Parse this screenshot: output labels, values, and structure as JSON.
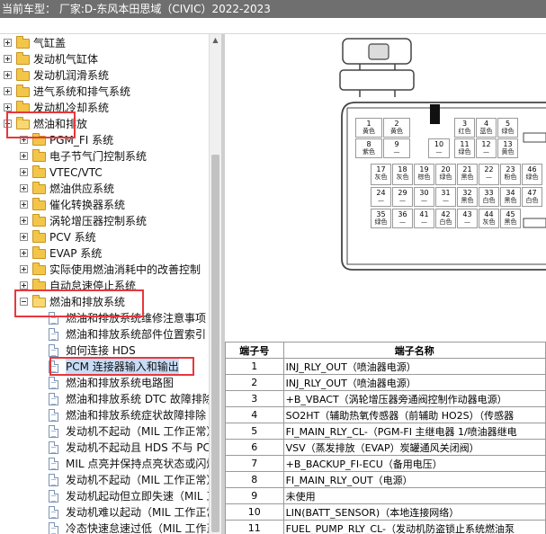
{
  "title_bar": "当前车型：  厂家:D-东风本田思域（CIVIC）2022-2023",
  "tree": [
    {
      "label": "气缸盖",
      "icon": "folder-icon",
      "level": 0,
      "expander": "plus"
    },
    {
      "label": "发动机气缸体",
      "icon": "folder-icon",
      "level": 0,
      "expander": "plus"
    },
    {
      "label": "发动机润滑系统",
      "icon": "folder-icon",
      "level": 0,
      "expander": "plus"
    },
    {
      "label": "进气系统和排气系统",
      "icon": "folder-icon",
      "level": 0,
      "expander": "plus"
    },
    {
      "label": "发动机冷却系统",
      "icon": "folder-icon",
      "level": 0,
      "expander": "plus"
    },
    {
      "label": "燃油和排放",
      "icon": "folder-open-icon",
      "level": 0,
      "expander": "minus"
    },
    {
      "label": "PGM_FI 系统",
      "icon": "folder-icon",
      "level": 1,
      "expander": "plus"
    },
    {
      "label": "电子节气门控制系统",
      "icon": "folder-icon",
      "level": 1,
      "expander": "plus"
    },
    {
      "label": "VTEC/VTC",
      "icon": "folder-icon",
      "level": 1,
      "expander": "plus"
    },
    {
      "label": "燃油供应系统",
      "icon": "folder-icon",
      "level": 1,
      "expander": "plus"
    },
    {
      "label": "催化转换器系统",
      "icon": "folder-icon",
      "level": 1,
      "expander": "plus"
    },
    {
      "label": "涡轮增压器控制系统",
      "icon": "folder-icon",
      "level": 1,
      "expander": "plus"
    },
    {
      "label": "PCV 系统",
      "icon": "folder-icon",
      "level": 1,
      "expander": "plus"
    },
    {
      "label": "EVAP 系统",
      "icon": "folder-icon",
      "level": 1,
      "expander": "plus"
    },
    {
      "label": "实际使用燃油消耗中的改善控制",
      "icon": "folder-icon",
      "level": 1,
      "expander": "plus"
    },
    {
      "label": "自动怠速停止系统",
      "icon": "folder-icon",
      "level": 1,
      "expander": "plus"
    },
    {
      "label": "燃油和排放系统",
      "icon": "folder-open-icon",
      "level": 1,
      "expander": "minus"
    },
    {
      "label": "燃油和排放系统维修注意事项",
      "icon": "document-icon",
      "level": 2
    },
    {
      "label": "燃油和排放系统部件位置索引",
      "icon": "document-icon",
      "level": 2
    },
    {
      "label": "如何连接 HDS",
      "icon": "document-icon",
      "level": 2
    },
    {
      "label": "PCM 连接器输入和输出",
      "icon": "document-icon",
      "level": 2,
      "selected": true
    },
    {
      "label": "燃油和排放系统电路图",
      "icon": "document-icon",
      "level": 2
    },
    {
      "label": "燃油和排放系统 DTC 故障排除",
      "icon": "document-icon",
      "level": 2
    },
    {
      "label": "燃油和排放系统症状故障排除",
      "icon": "document-icon",
      "level": 2
    },
    {
      "label": "发动机不起动（MIL 工作正常）",
      "icon": "document-icon",
      "level": 2
    },
    {
      "label": "发动机不起动且 HDS 不与 PCM 通信",
      "icon": "document-icon",
      "level": 2
    },
    {
      "label": "MIL 点亮并保持点亮状态或闪烁",
      "icon": "document-icon",
      "level": 2
    },
    {
      "label": "发动机不起动（MIL 工作正常）",
      "icon": "document-icon",
      "level": 2
    },
    {
      "label": "发动机起动但立即失速（MIL 工作正常）",
      "icon": "document-icon",
      "level": 2
    },
    {
      "label": "发动机难以起动（MIL 工作正常）",
      "icon": "document-icon",
      "level": 2
    },
    {
      "label": "冷态快速怠速过低（MIL 工作正常）",
      "icon": "document-icon",
      "level": 2
    }
  ],
  "connector": {
    "cells": [
      {
        "n": "1",
        "c": "黄色"
      },
      {
        "n": "2",
        "c": "黄色"
      },
      {
        "n": "3",
        "c": "红色"
      },
      {
        "n": "4",
        "c": "蓝色"
      },
      {
        "n": "5",
        "c": "绿色"
      },
      {
        "n": "8",
        "c": "紫色"
      },
      {
        "n": "9",
        "c": "—"
      },
      {
        "n": "10",
        "c": "—"
      },
      {
        "n": "11",
        "c": "绿色"
      },
      {
        "n": "12",
        "c": "—"
      },
      {
        "n": "13",
        "c": "黄色"
      },
      {
        "n": "17",
        "c": "灰色"
      },
      {
        "n": "18",
        "c": "灰色"
      },
      {
        "n": "19",
        "c": "棕色"
      },
      {
        "n": "20",
        "c": "绿色"
      },
      {
        "n": "21",
        "c": "黑色"
      },
      {
        "n": "22",
        "c": "—"
      },
      {
        "n": "23",
        "c": "粉色"
      },
      {
        "n": "24",
        "c": "—"
      },
      {
        "n": "29",
        "c": "—"
      },
      {
        "n": "30",
        "c": "—"
      },
      {
        "n": "31",
        "c": "—"
      },
      {
        "n": "32",
        "c": "黑色"
      },
      {
        "n": "33",
        "c": "白色"
      },
      {
        "n": "34",
        "c": "黑色"
      },
      {
        "n": "35",
        "c": "绿色"
      },
      {
        "n": "36",
        "c": "—"
      },
      {
        "n": "41",
        "c": "—"
      },
      {
        "n": "42",
        "c": "白色"
      },
      {
        "n": "43",
        "c": "—"
      },
      {
        "n": "44",
        "c": "灰色"
      },
      {
        "n": "45",
        "c": "黑色"
      },
      {
        "n": "46",
        "c": "绿色"
      },
      {
        "n": "47",
        "c": "白色"
      }
    ]
  },
  "pin_table": {
    "headers": [
      "端子号",
      "端子名称"
    ],
    "rows": [
      [
        "1",
        "INJ_RLY_OUT（喷油器电源）"
      ],
      [
        "2",
        "INJ_RLY_OUT（喷油器电源）"
      ],
      [
        "3",
        "+B_VBACT（涡轮增压器旁通阀控制作动器电源）"
      ],
      [
        "4",
        "SO2HT（辅助热氧传感器（前辅助 HO2S）（传感器"
      ],
      [
        "5",
        "FI_MAIN_RLY_CL-（PGM-FI 主继电器 1/喷油器继电"
      ],
      [
        "6",
        "VSV（蒸发排放（EVAP）炭罐通风关闭阀）"
      ],
      [
        "7",
        "+B_BACKUP_FI-ECU（备用电压）"
      ],
      [
        "8",
        "FI_MAIN_RLY_OUT（电源）"
      ],
      [
        "9",
        "未使用"
      ],
      [
        "10",
        "LIN(BATT_SENSOR)（本地连接网络）"
      ],
      [
        "11",
        "FUEL_PUMP_RLY_CL-（发动机防盗锁止系统燃油泵"
      ]
    ]
  }
}
